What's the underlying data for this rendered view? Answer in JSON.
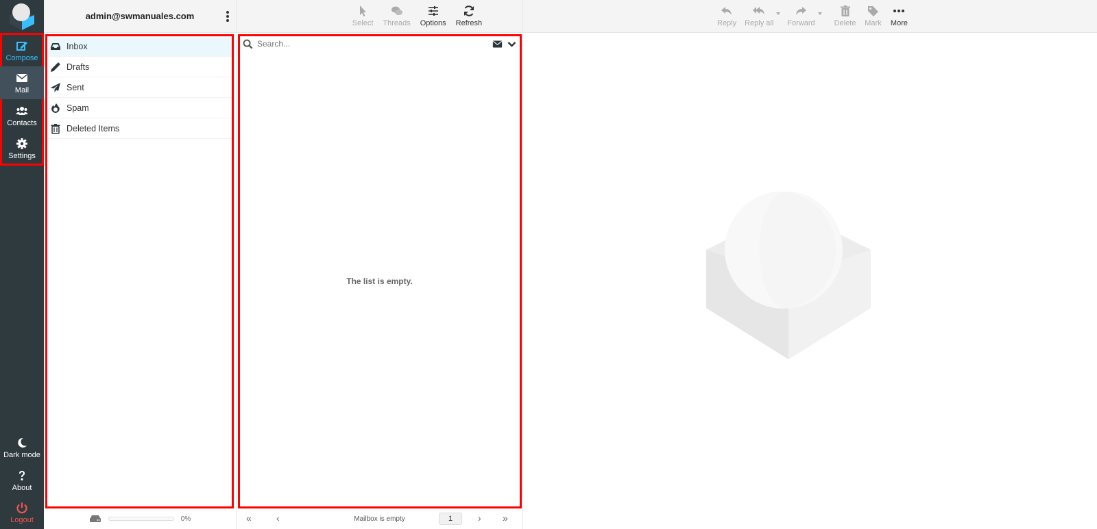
{
  "account": {
    "email": "admin@swmanuales.com"
  },
  "taskbar": {
    "compose": "Compose",
    "mail": "Mail",
    "contacts": "Contacts",
    "settings": "Settings",
    "dark_mode": "Dark mode",
    "about": "About",
    "logout": "Logout"
  },
  "folders": {
    "items": [
      {
        "label": "Inbox",
        "icon": "inbox-icon",
        "selected": true
      },
      {
        "label": "Drafts",
        "icon": "pencil-icon"
      },
      {
        "label": "Sent",
        "icon": "paper-plane-icon"
      },
      {
        "label": "Spam",
        "icon": "fire-icon"
      },
      {
        "label": "Deleted Items",
        "icon": "trash-icon"
      }
    ],
    "quota": {
      "label": "0%",
      "percent": 0
    }
  },
  "list_toolbar": {
    "select": "Select",
    "threads": "Threads",
    "options": "Options",
    "refresh": "Refresh"
  },
  "search": {
    "placeholder": "Search..."
  },
  "list": {
    "empty_message": "The list is empty.",
    "status": "Mailbox is empty",
    "page": "1"
  },
  "message_toolbar": {
    "reply": "Reply",
    "reply_all": "Reply all",
    "forward": "Forward",
    "delete": "Delete",
    "mark": "Mark",
    "more": "More"
  },
  "colors": {
    "accent": "#37beff",
    "taskbar": "#2f3a3f",
    "logout": "#ee5750",
    "highlight_outline": "#ff0000",
    "selected_folder": "#eaf8fe"
  }
}
